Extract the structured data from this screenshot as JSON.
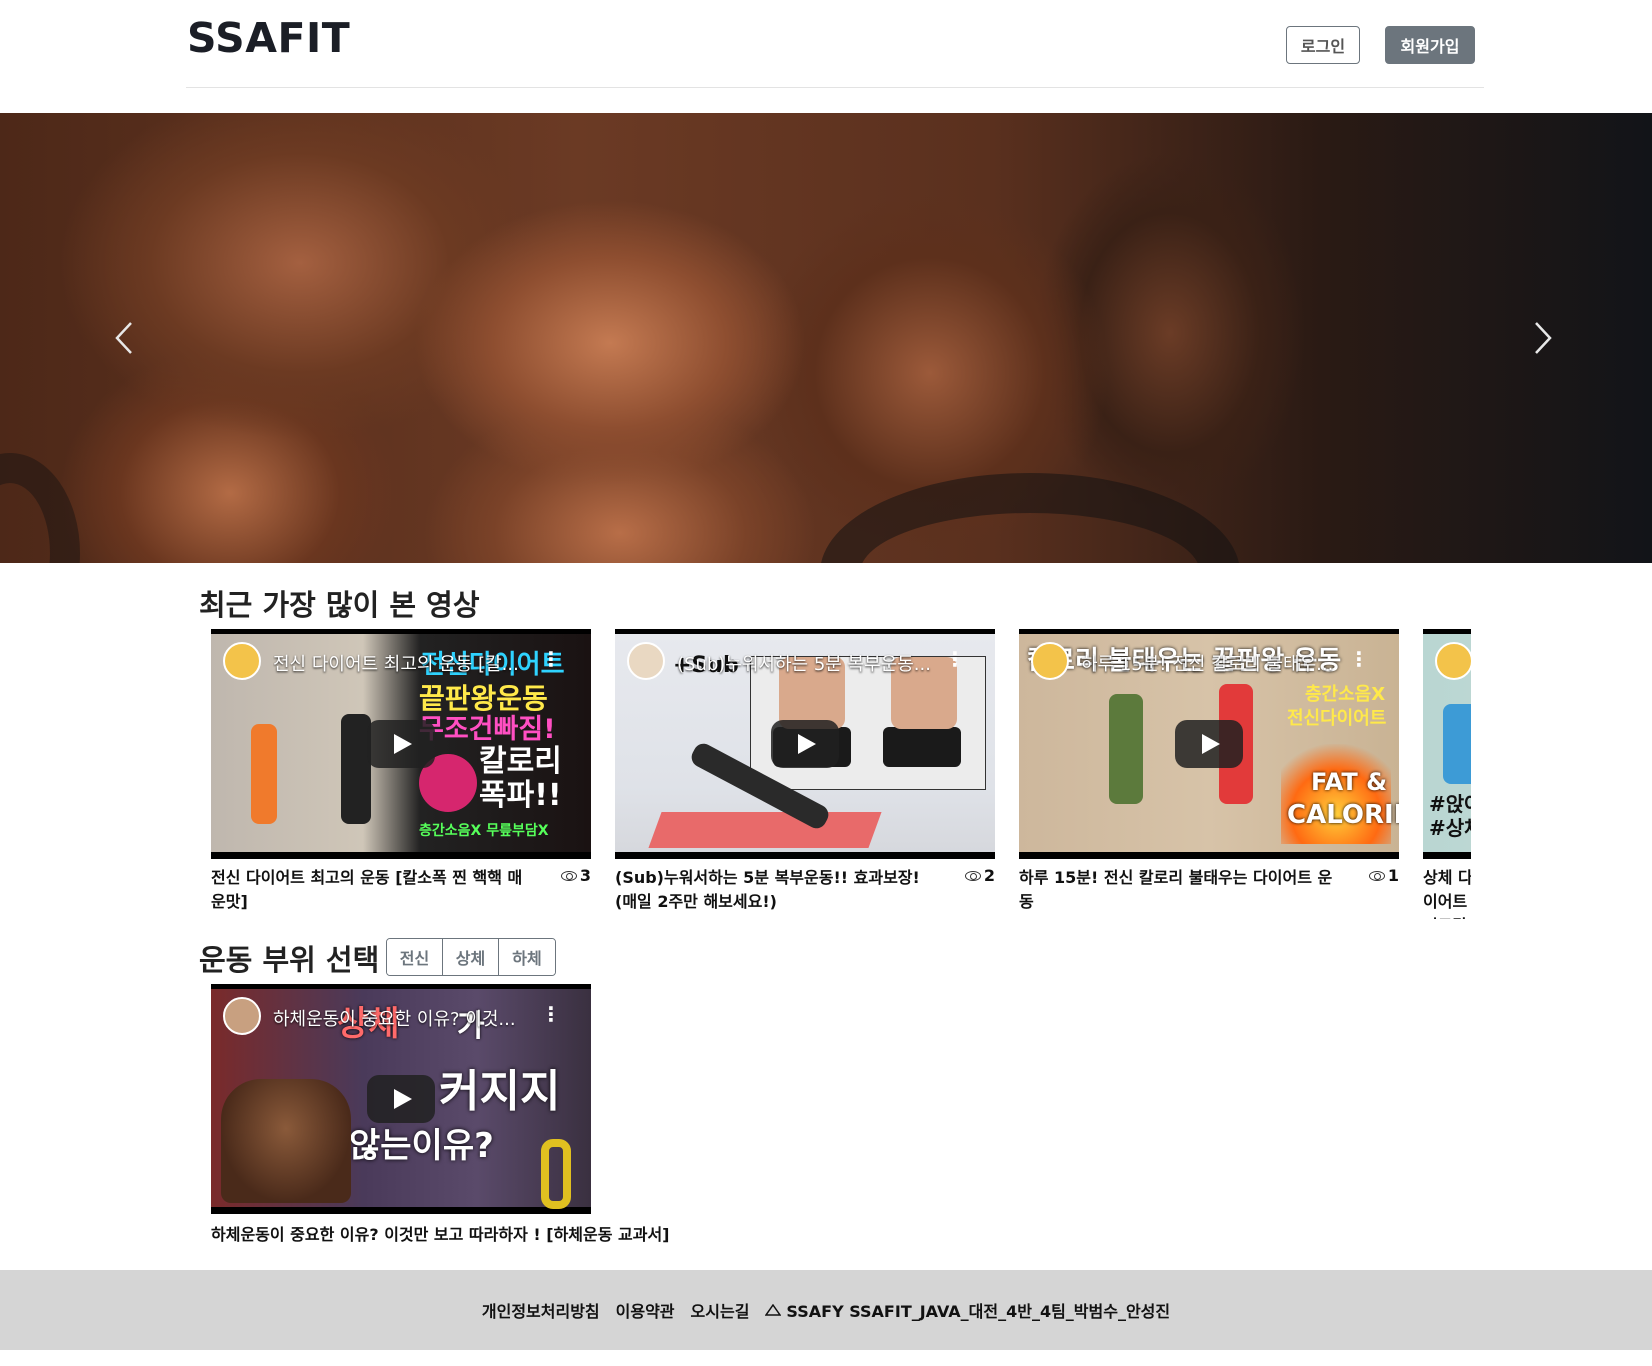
{
  "header": {
    "logo": "SSAFIT",
    "login_label": "로그인",
    "signup_label": "회원가입"
  },
  "carousel": {
    "prev_icon": "chevron-left-icon",
    "next_icon": "chevron-right-icon"
  },
  "popular": {
    "title": "최근 가장 많이 본 영상",
    "videos": [
      {
        "thumb_title": "전신 다이어트 최고의 운동 [칼...",
        "title": "전신 다이어트 최고의 운동 [칼소폭 찐 핵핵 매운맛]",
        "views": "3",
        "overlay": [
          "전신다이어트",
          "끝판왕운동",
          "무조건빠짐!",
          "칼로리",
          "폭파!!",
          "층간소음X 무릎부담X"
        ]
      },
      {
        "thumb_title": "(Sub)누워서하는 5분 복부운동...",
        "title": "(Sub)누워서하는 5분 복부운동!! 효과보장! (매일 2주만 해보세요!)",
        "views": "2",
        "overlay": [
          "+Sub"
        ]
      },
      {
        "thumb_title": "하루 15분! 전신 칼로리 불태우...",
        "title": "하루 15분! 전신 칼로리 불태우는 다이어트 운동",
        "views": "1",
        "overlay": [
          "칼로리 불태우는 끝판왕 운동",
          "층간소음X",
          "전신다이어트",
          "FAT &",
          "CALORIE"
        ]
      },
      {
        "thumb_title": "",
        "title": "상체 다이어트 겨드랑",
        "views": "",
        "overlay": [
          "#앉아",
          "#상체"
        ]
      }
    ]
  },
  "parts": {
    "title": "운동 부위 선택",
    "buttons": [
      "전신",
      "상체",
      "하체"
    ],
    "video": {
      "thumb_title": "하체운동이 중요한 이유? 이것...",
      "title": "하체운동이 중요한 이유? 이것만 보고 따라하자 ! [하체운동 교과서]",
      "overlay": [
        "상체",
        "가",
        "커지지",
        "않는이유?"
      ]
    }
  },
  "footer": {
    "privacy": "개인정보처리방침",
    "terms": "이용약관",
    "directions": "오시는길",
    "copyright": "SSAFY SSAFIT_JAVA_대전_4반_4팀_박범수_안성진"
  }
}
